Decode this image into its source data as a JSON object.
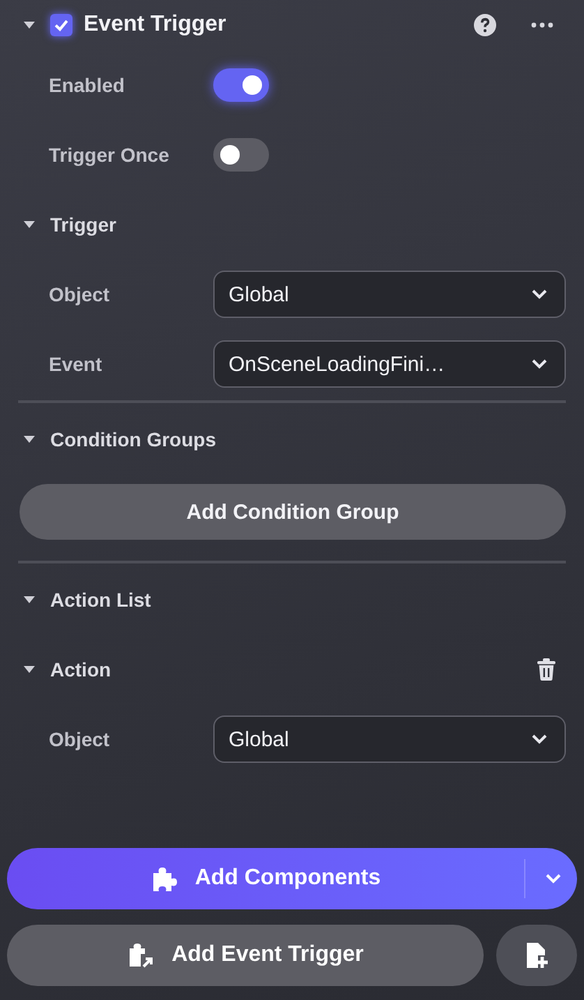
{
  "component": {
    "title": "Event Trigger",
    "expanded": true,
    "checked": true
  },
  "properties": [
    {
      "label": "Enabled",
      "kind": "toggle",
      "on": true
    },
    {
      "label": "Trigger Once",
      "kind": "toggle",
      "on": false
    }
  ],
  "trigger": {
    "title": "Trigger",
    "expanded": true,
    "fields": [
      {
        "label": "Object",
        "value": "Global"
      },
      {
        "label": "Event",
        "value": "OnSceneLoadingFini…"
      }
    ]
  },
  "condition_groups": {
    "title": "Condition Groups",
    "expanded": true,
    "button": "Add Condition Group"
  },
  "action_list": {
    "title": "Action List",
    "expanded": true,
    "actions": [
      {
        "title": "Action",
        "expanded": true,
        "fields": [
          {
            "label": "Object",
            "value": "Global"
          }
        ]
      }
    ]
  },
  "footer": {
    "add_components": "Add Components",
    "add_event_trigger": "Add Event Trigger"
  }
}
